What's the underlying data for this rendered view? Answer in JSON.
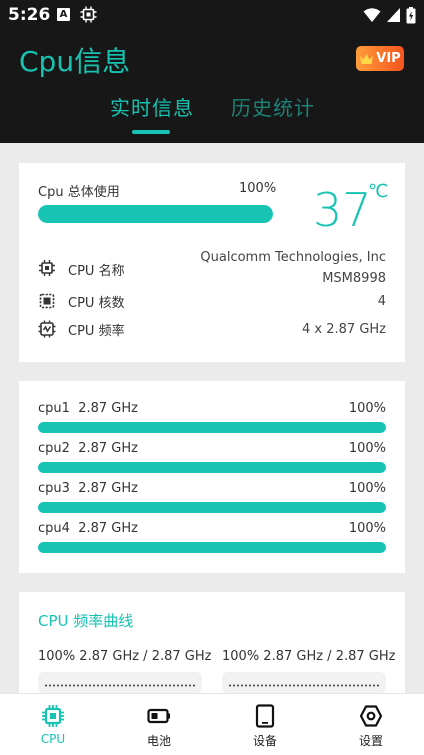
{
  "status_bar": {
    "time": "5:26",
    "left_icons": [
      "a-icon",
      "chip-icon"
    ],
    "right_icons": [
      "wifi-icon",
      "signal-icon",
      "battery-icon"
    ]
  },
  "header": {
    "title": "Cpu信息",
    "vip_label": "VIP"
  },
  "tabs": [
    {
      "label": "实时信息",
      "active": true
    },
    {
      "label": "历史统计",
      "active": false
    }
  ],
  "overview": {
    "usage_label": "Cpu 总体使用",
    "usage_percent_text": "100%",
    "usage_fraction": 1.0,
    "temperature": "37",
    "temperature_unit": "℃",
    "info": {
      "name_label": "CPU 名称",
      "name_value_line1": "Qualcomm Technologies, Inc",
      "name_value_line2": "MSM8998",
      "cores_label": "CPU 核数",
      "cores_value": "4",
      "freq_label": "CPU 频率",
      "freq_value": "4 x 2.87 GHz"
    }
  },
  "cores": [
    {
      "name": "cpu1",
      "freq": "2.87 GHz",
      "percent_text": "100%",
      "usage_fraction": 1.0
    },
    {
      "name": "cpu2",
      "freq": "2.87 GHz",
      "percent_text": "100%",
      "usage_fraction": 1.0
    },
    {
      "name": "cpu3",
      "freq": "2.87 GHz",
      "percent_text": "100%",
      "usage_fraction": 1.0
    },
    {
      "name": "cpu4",
      "freq": "2.87 GHz",
      "percent_text": "100%",
      "usage_fraction": 1.0
    }
  ],
  "freq_curve": {
    "title": "CPU 频率曲线",
    "items": [
      {
        "text": "100% 2.87 GHz / 2.87 GHz"
      },
      {
        "text": "100% 2.87 GHz / 2.87 GHz"
      }
    ]
  },
  "bottom_nav": [
    {
      "label": "CPU",
      "icon": "cpu-icon",
      "active": true
    },
    {
      "label": "电池",
      "icon": "battery-icon",
      "active": false
    },
    {
      "label": "设备",
      "icon": "tablet-icon",
      "active": false
    },
    {
      "label": "设置",
      "icon": "settings-icon",
      "active": false
    }
  ],
  "colors": {
    "accent": "#17c3b2",
    "header_bg": "#171717",
    "page_bg": "#ebebeb",
    "vip_gradient_start": "#ff9c3a",
    "vip_gradient_end": "#f5541e"
  }
}
